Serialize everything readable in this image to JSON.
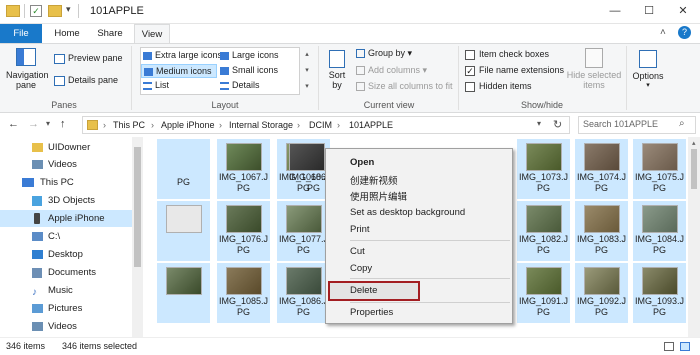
{
  "window": {
    "title": "101APPLE",
    "minimize": "—",
    "maximize": "☐",
    "close": "✕",
    "help": "?",
    "expand": "˄"
  },
  "tabs": [
    "File",
    "Home",
    "Share",
    "View"
  ],
  "ribbon": {
    "panes": {
      "nav_pane_label": "Navigation pane",
      "preview_pane": "Preview pane",
      "details_pane": "Details pane",
      "group": "Panes"
    },
    "layout": {
      "extra_large": "Extra large icons",
      "large": "Large icons",
      "medium": "Medium icons",
      "small": "Small icons",
      "list": "List",
      "details": "Details",
      "group": "Layout"
    },
    "current_view": {
      "sort_by": "Sort by",
      "group_by": "Group by",
      "add_columns": "Add columns",
      "size_columns": "Size all columns to fit",
      "group": "Current view"
    },
    "show_hide": {
      "item_checkboxes": "Item check boxes",
      "file_name_ext": "File name extensions",
      "hidden_items": "Hidden items",
      "hide_selected": "Hide selected items",
      "group": "Show/hide"
    },
    "options": "Options"
  },
  "address": {
    "path": [
      "This PC",
      "Apple iPhone",
      "Internal Storage",
      "DCIM",
      "101APPLE"
    ],
    "search_placeholder": "Search 101APPLE"
  },
  "nav": [
    {
      "label": "UIDowner",
      "icon": "folder-icon",
      "color": "#e8c04a"
    },
    {
      "label": "Videos",
      "icon": "videos-folder-icon",
      "color": "#6b8fb3"
    },
    {
      "label": "This PC",
      "icon": "computer-icon",
      "color": "#3a7bd5"
    },
    {
      "label": "3D Objects",
      "icon": "3d-objects-icon",
      "color": "#4aa3df"
    },
    {
      "label": "Apple iPhone",
      "icon": "phone-icon",
      "color": "#444444"
    },
    {
      "label": "C:\\",
      "icon": "drive-icon",
      "color": "#5b8cc7"
    },
    {
      "label": "Desktop",
      "icon": "desktop-icon",
      "color": "#2f7fd1"
    },
    {
      "label": "Documents",
      "icon": "documents-icon",
      "color": "#6d8fb5"
    },
    {
      "label": "Music",
      "icon": "music-icon",
      "color": "#3f74c4"
    },
    {
      "label": "Pictures",
      "icon": "pictures-icon",
      "color": "#5b9bd5"
    },
    {
      "label": "Videos",
      "icon": "videos-folder-icon",
      "color": "#6b8fb3"
    }
  ],
  "files_row1": [
    "",
    "IMG_1067.JPG",
    "IMG_1068.JPG",
    "IMG_1069.JPG",
    "",
    "IMG_1073.JPG",
    "IMG_1074.JPG",
    "IMG_1075.JPG"
  ],
  "files_row2": [
    "",
    "IMG_1076.JPG",
    "IMG_1077.JPG",
    "",
    "",
    "IMG_1082.JPG",
    "IMG_1083.JPG",
    "IMG_1084.JPG"
  ],
  "files_row3": [
    "",
    "IMG_1085.JPG",
    "IMG_1086.JPG",
    "",
    "",
    "IMG_1091.JPG",
    "IMG_1092.JPG",
    "IMG_1093.JPG"
  ],
  "files_row1_labels": [
    "PG",
    "IMG_1067.J PG",
    "IMG_1068.J PG",
    "IMG_1069.J PG",
    "",
    "IMG_1073.J PG",
    "IMG_1074.J PG",
    "IMG_1075.J PG"
  ],
  "context_menu": {
    "open": "Open",
    "create_video": "创建新视频",
    "edit_photos": "使用照片编辑",
    "set_bg": "Set as desktop background",
    "print": "Print",
    "cut": "Cut",
    "copy": "Copy",
    "delete": "Delete",
    "properties": "Properties"
  },
  "status": {
    "count": "346 items",
    "selected": "346 items selected"
  },
  "colors": {
    "selection": "#cce8ff",
    "accent": "#1979ca",
    "highlight_box": "#a31e22"
  }
}
